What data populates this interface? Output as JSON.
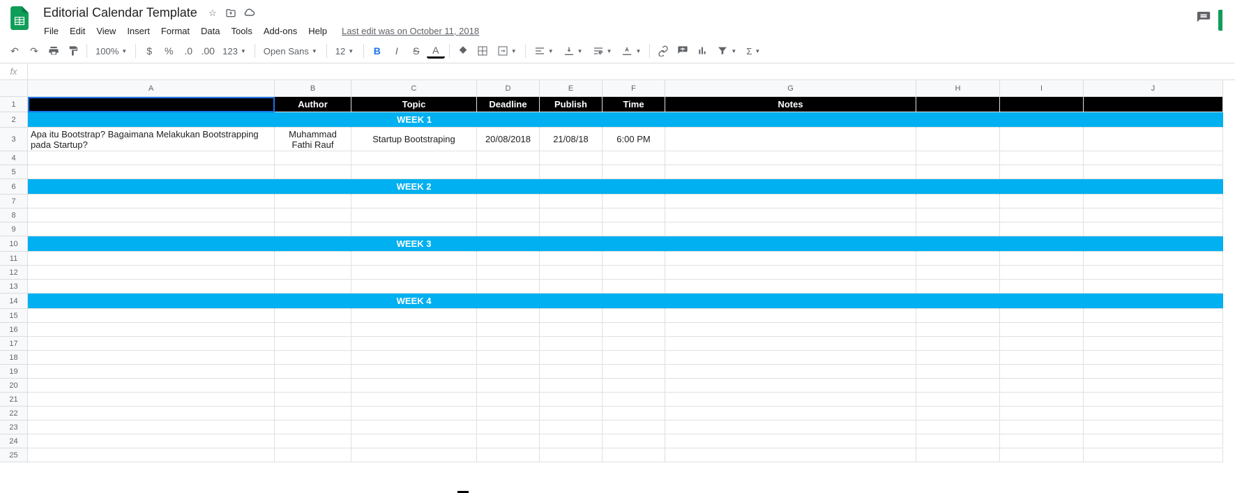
{
  "doc": {
    "title": "Editorial Calendar Template"
  },
  "menu": {
    "file": "File",
    "edit": "Edit",
    "view": "View",
    "insert": "Insert",
    "format": "Format",
    "data": "Data",
    "tools": "Tools",
    "addons": "Add-ons",
    "help": "Help",
    "last_edit": "Last edit was on October 11, 2018"
  },
  "toolbar": {
    "zoom": "100%",
    "font": "Open Sans",
    "font_size": "12",
    "currency": "$",
    "percent": "%",
    "dec_less": ".0",
    "dec_more": ".00",
    "num_fmt": "123",
    "bold": "B",
    "italic": "I",
    "strike": "S",
    "text_color": "A"
  },
  "columns": [
    "A",
    "B",
    "C",
    "D",
    "E",
    "F",
    "G",
    "H",
    "I",
    "J"
  ],
  "rows": [
    "1",
    "2",
    "3",
    "4",
    "5",
    "6",
    "7",
    "8",
    "9",
    "10",
    "11",
    "12",
    "13",
    "14",
    "15",
    "16",
    "17",
    "18",
    "19",
    "20",
    "21",
    "22",
    "23",
    "24",
    "25"
  ],
  "headers": {
    "A": "",
    "B": "Author",
    "C": "Topic",
    "D": "Deadline",
    "E": "Publish",
    "F": "Time",
    "G": "Notes"
  },
  "weeks": {
    "w1": "WEEK 1",
    "w2": "WEEK 2",
    "w3": "WEEK 3",
    "w4": "WEEK 4"
  },
  "data_row": {
    "A": "Apa itu Bootstrap? Bagaimana Melakukan Bootstrapping pada Startup?",
    "B": "Muhammad Fathi Rauf",
    "C": "Startup Bootstraping",
    "D": "20/08/2018",
    "E": "21/08/18",
    "F": "6:00 PM"
  },
  "fx": "fx"
}
